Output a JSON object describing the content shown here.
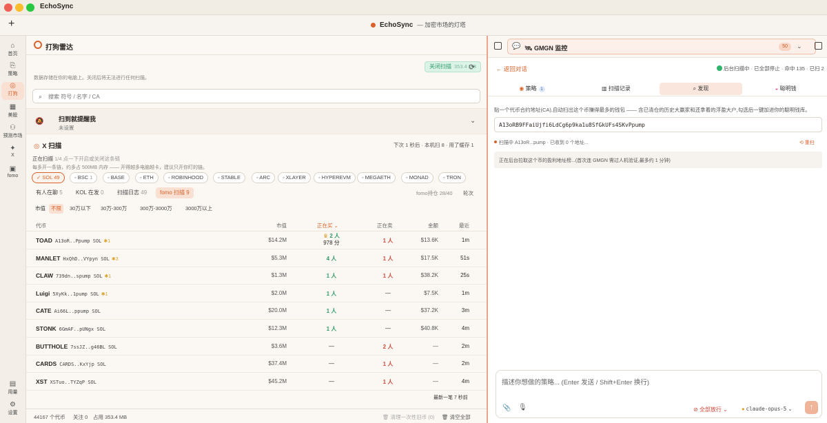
{
  "window": {
    "title": "EchoSync"
  },
  "toolbar": {
    "plus": "+",
    "app_name": "EchoSync",
    "tagline": "— 加密市场的灯塔"
  },
  "rail": [
    {
      "label": "首页",
      "icon": "⌂"
    },
    {
      "label": "策略",
      "icon": "⎘"
    },
    {
      "label": "打狗",
      "icon": "◎"
    },
    {
      "label": "美股",
      "icon": "▦"
    },
    {
      "label": "预测市场",
      "icon": "⚇"
    },
    {
      "label": "X",
      "icon": "✦"
    },
    {
      "label": "fomo",
      "icon": "▣"
    },
    {
      "label": "用量",
      "icon": "▤"
    },
    {
      "label": "设置",
      "icon": "⚙"
    }
  ],
  "main": {
    "title": "打狗雷达",
    "scan_button": "关闭扫描",
    "scan_size": "353.4 MB",
    "note": "数据存储在你的电脑上。关闭后将无法进行任何扫描。",
    "search_placeholder": "搜索 符号 / 名字 / CA",
    "alert_title": "扫到就提醒我",
    "alert_sub": "未设置",
    "xscan_title": "X 扫描",
    "xscan_right": "下次 1 秒后 · 本机扫 8 · 用了缓存 1",
    "scan_status": "正在扫描",
    "scan_count": "1/4",
    "scan_hint": "点一下开启或关闭这条链",
    "scan_line2": "每多开一条链，约多占 500MB 内存 —— 开得越多电脑越卡，建议只开你盯的链。",
    "chains": [
      {
        "name": "✓ SOL",
        "count": "49",
        "on": true
      },
      {
        "name": "BSC",
        "count": "1"
      },
      {
        "name": "BASE",
        "count": ""
      },
      {
        "name": "ETH",
        "count": ""
      },
      {
        "name": "ROBINHOOD",
        "count": ""
      },
      {
        "name": "STABLE",
        "count": ""
      },
      {
        "name": "ARC",
        "count": ""
      },
      {
        "name": "XLAYER",
        "count": ""
      },
      {
        "name": "HYPEREVM",
        "count": ""
      },
      {
        "name": "MEGAETH",
        "count": ""
      },
      {
        "name": "MONAD",
        "count": ""
      },
      {
        "name": "TRON",
        "count": ""
      }
    ],
    "tabs": [
      {
        "name": "有人在聊",
        "count": "5"
      },
      {
        "name": "KOL 在发",
        "count": "0"
      },
      {
        "name": "扫描日志",
        "count": "49"
      },
      {
        "name": "fomo 扫描",
        "count": "9",
        "on": true
      }
    ],
    "fomo_hold": "fomo持仓 28/40",
    "rounds": "轮次",
    "mcap_label": "市值",
    "mcap_filters": [
      "不限",
      "30万以下",
      "30万-300万",
      "300万-3000万",
      "3000万以上"
    ],
    "columns": {
      "token": "代币",
      "mcap": "市值",
      "buying": "正在买 ⌄",
      "selling": "正在卖",
      "amount": "金额",
      "recent": "最近"
    },
    "rows": [
      {
        "sym": "TOAD",
        "addr": "A13oR..Ppump SOL",
        "fire": "1",
        "mcap": "$14.2M",
        "buy": "2 人",
        "buy_sub": "978 分",
        "crown": true,
        "sell": "1 人",
        "amt": "$13.6K",
        "rec": "1m"
      },
      {
        "sym": "MANLET",
        "addr": "HxQhD..VYpyn SOL",
        "fire": "3",
        "mcap": "$5.3M",
        "buy": "4 人",
        "sell": "1 人",
        "amt": "$17.5K",
        "rec": "51s"
      },
      {
        "sym": "CLAW",
        "addr": "739dn..spump SOL",
        "fire": "1",
        "mcap": "$1.3M",
        "buy": "1 人",
        "sell": "1 人",
        "amt": "$38.2K",
        "rec": "25s"
      },
      {
        "sym": "Luigi",
        "addr": "5XyKk..1pump SOL",
        "fire": "1",
        "mcap": "$2.0M",
        "buy": "1 人",
        "sell": "—",
        "amt": "$7.5K",
        "rec": "1m"
      },
      {
        "sym": "CATE",
        "addr": "Ai66L..ppump SOL",
        "fire": "",
        "mcap": "$20.0M",
        "buy": "1 人",
        "sell": "—",
        "amt": "$37.2K",
        "rec": "3m"
      },
      {
        "sym": "STONK",
        "addr": "6GmAF..pUNgx SOL",
        "fire": "",
        "mcap": "$12.3M",
        "buy": "1 人",
        "sell": "—",
        "amt": "$40.8K",
        "rec": "4m"
      },
      {
        "sym": "BUTTHOLE",
        "addr": "7ssJZ..g46BL SOL",
        "fire": "",
        "mcap": "$3.6M",
        "buy": "—",
        "sell": "2 人",
        "amt": "—",
        "rec": "2m"
      },
      {
        "sym": "CARDS",
        "addr": "CARDS..KxYjp SOL",
        "fire": "",
        "mcap": "$37.4M",
        "buy": "—",
        "sell": "1 人",
        "amt": "—",
        "rec": "2m"
      },
      {
        "sym": "XST",
        "addr": "XSTuo..TYZqP SOL",
        "fire": "",
        "mcap": "$45.2M",
        "buy": "—",
        "sell": "1 人",
        "amt": "—",
        "rec": "4m"
      }
    ],
    "latest": "最新一笔 7 秒前",
    "footer": {
      "tokens": "44167 个代币",
      "follow": "关注 0",
      "usage": "占用 353.4 MB",
      "clear_once": "清理一次性旧币 (0)",
      "clear_all": "清空全部"
    }
  },
  "right": {
    "title": "GMGN 监控",
    "badge": "50",
    "back": "← 返回对话",
    "status": "后台扫描中 · 已全部停止 · 命中 135 · 已扫 2",
    "tabs": [
      {
        "name": "策略",
        "badge": "1",
        "icon": "◉"
      },
      {
        "name": "扫描记录",
        "icon": "▥"
      },
      {
        "name": "发现",
        "icon": "⌕",
        "on": true
      },
      {
        "name": "聪明钱",
        "icon": "◒"
      }
    ],
    "paste_hint": "贴一个代币合约地址(CA),自动扫出这个币赚得最多的钱包 —— 含已清仓的历史大赢家和还拿着的浮盈大户,勾选后一键加进你的聪明钱库。",
    "ca_value": "A13oRB9FFaiUjfi6LdCg6p9ka1u8SfGkUFs4SKvPpump",
    "scanning": "扫描中 A13oR...pump · 已收到 0 个地址...",
    "rescan": "⟲ 重扫",
    "pending": "正在后台拉取这个币的盈利地址榜...(首次连 GMGN 需过人机验证,最多约 1 分钟)",
    "composer_placeholder": "描述你想做的策略... (Enter 发送 / Shift+Enter 换行)",
    "permission": "全部放行",
    "model": "claude-opus-5",
    "send": "↑"
  }
}
